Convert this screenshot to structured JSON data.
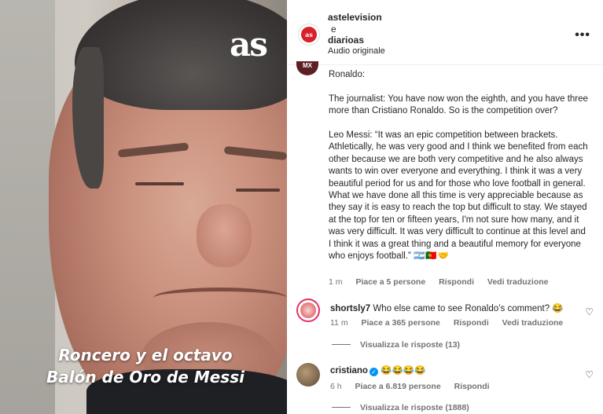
{
  "video": {
    "logo": "as",
    "caption_line1": "Roncero y el octavo",
    "caption_line2": "Balón de Oro de Messi"
  },
  "header": {
    "avatar_text": "as tv",
    "user1": "astelevision",
    "connector": "e",
    "user2": "diarioas",
    "audio": "Audio originale",
    "more_icon": "more-horizontal-icon"
  },
  "post": {
    "avatar_text": "MX",
    "paragraphs": [
      "Ronaldo:",
      "The journalist: You have now won the eighth, and you have three more than Cristiano Ronaldo. So is the competition over?",
      "Leo Messi: “It was an epic competition between brackets. Athletically, he was very good and I think we benefited from each other because we are both very competitive and he also always wants to win over everyone and everything. I think it was a very beautiful period for us and for those who love football in general. What we have done all this time is very appreciable because as they say it is easy to reach the top but difficult to stay. We stayed at the top for ten or fifteen years, I'm not sure how many, and it was very difficult. It was very difficult to continue at this level and I think it was a great thing and a beautiful memory for everyone who enjoys football.”"
    ],
    "flags": "🇦🇷🇵🇹🤝",
    "time": "1 m",
    "likes": "Piace a 5 persone",
    "reply": "Rispondi",
    "translate": "Vedi traduzione"
  },
  "comments": [
    {
      "user": "shortsly7",
      "text": "Who else came to see Ronaldo’s comment? 😂",
      "time": "11 m",
      "likes": "Piace a 365 persone",
      "reply": "Rispondi",
      "translate": "Vedi traduzione",
      "replies": "Visualizza le risposte (13)"
    },
    {
      "user": "cristiano",
      "verified": true,
      "text": "😂😂😂😂",
      "time": "6 h",
      "likes": "Piace a 6.819 persone",
      "reply": "Rispondi",
      "replies": "Visualizza le risposte (1888)"
    }
  ],
  "icons": {
    "heart": "heart-icon",
    "verified": "verified-badge-icon"
  }
}
